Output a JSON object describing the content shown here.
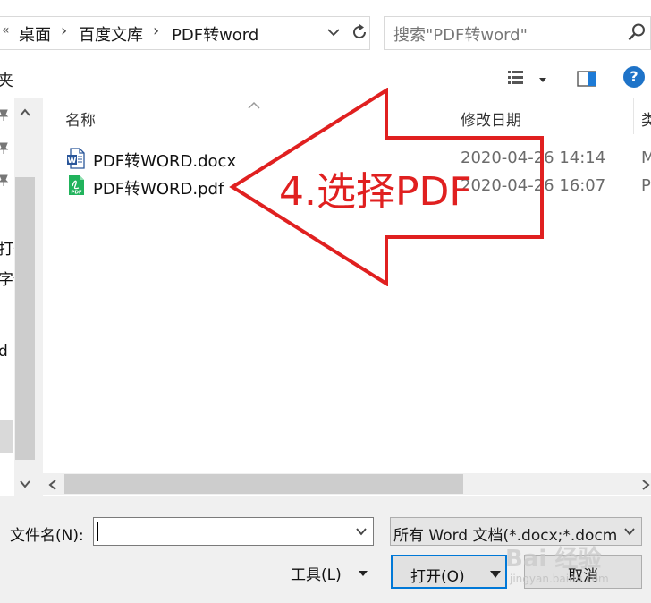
{
  "address_bar": {
    "prefix": "«",
    "crumbs": [
      "桌面",
      "百度文库",
      "PDF转word"
    ],
    "sep": "›"
  },
  "search": {
    "placeholder": "搜索\"PDF转word\""
  },
  "toolbar": {
    "left_text": "夹",
    "help": "?"
  },
  "columns": {
    "name": "名称",
    "date": "修改日期",
    "type": "类"
  },
  "files": [
    {
      "name": "PDF转WORD.docx",
      "date": "2020-04-26 14:14",
      "type": "M",
      "icon": "word-doc-icon",
      "icon_color": "#2b579a"
    },
    {
      "name": "PDF转WORD.pdf",
      "date": "2020-04-26 16:07",
      "type": "P",
      "icon": "pdf-doc-icon",
      "icon_color": "#21b35c",
      "icon_text": "PDF"
    }
  ],
  "nav_fragments": [
    "打开",
    "字体",
    "d"
  ],
  "annotation": {
    "text": "4.选择PDF",
    "color": "#e02020"
  },
  "bottom": {
    "filename_label": "文件名(N):",
    "filename_value": "",
    "filetype_value": "所有 Word 文档(*.docx;*.docm",
    "tools_label": "工具(L)",
    "open_label": "打开(O)",
    "cancel_label": "取消"
  },
  "watermark": {
    "text": "Bai 经验",
    "sub": "jingyan.baidu.com"
  }
}
